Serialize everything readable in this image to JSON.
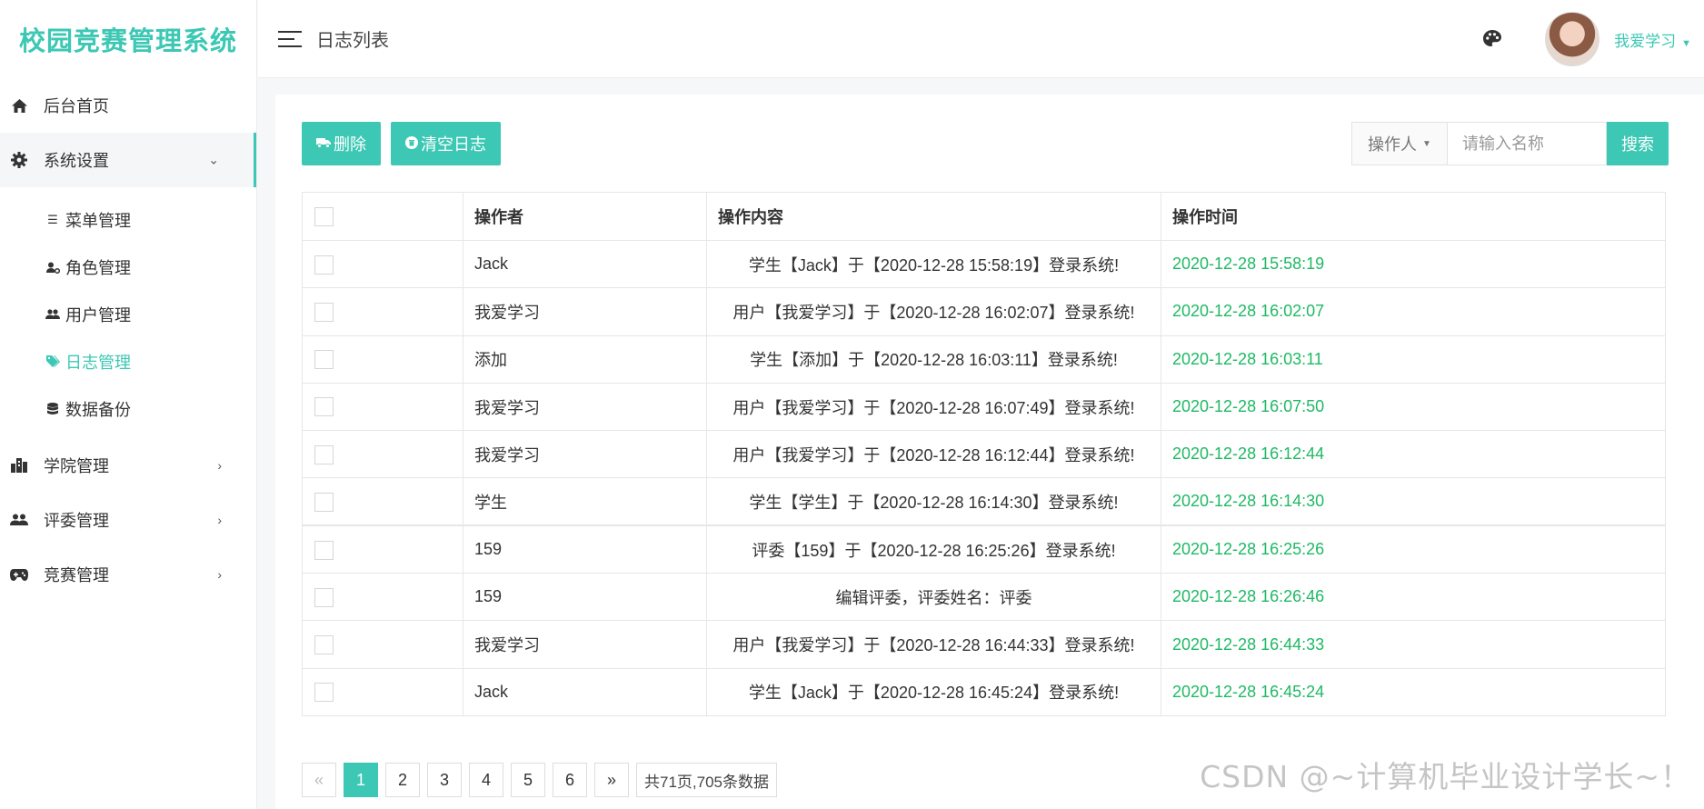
{
  "app": {
    "title": "校园竞赛管理系统"
  },
  "sidebar": {
    "items": [
      {
        "label": "后台首页",
        "icon": "home-icon"
      },
      {
        "label": "系统设置",
        "icon": "gear-icon",
        "expanded": true,
        "children": [
          {
            "label": "菜单管理",
            "icon": "list-icon"
          },
          {
            "label": "角色管理",
            "icon": "user-cog-icon"
          },
          {
            "label": "用户管理",
            "icon": "users-icon"
          },
          {
            "label": "日志管理",
            "icon": "tags-icon",
            "active": true
          },
          {
            "label": "数据备份",
            "icon": "database-icon"
          }
        ]
      },
      {
        "label": "学院管理",
        "icon": "building-icon"
      },
      {
        "label": "评委管理",
        "icon": "group-icon"
      },
      {
        "label": "竞赛管理",
        "icon": "gamepad-icon"
      }
    ]
  },
  "header": {
    "page_title": "日志列表",
    "username": "我爱学习"
  },
  "toolbar": {
    "delete_label": "删除",
    "clear_label": "清空日志"
  },
  "search": {
    "select_label": "操作人",
    "placeholder": "请输入名称",
    "button_label": "搜索"
  },
  "table": {
    "columns": [
      "",
      "操作者",
      "操作内容",
      "操作时间"
    ],
    "rows": [
      {
        "operator": "Jack",
        "content": "学生【Jack】于【2020-12-28 15:58:19】登录系统!",
        "time": "2020-12-28 15:58:19"
      },
      {
        "operator": "我爱学习",
        "content": "用户【我爱学习】于【2020-12-28 16:02:07】登录系统!",
        "time": "2020-12-28 16:02:07"
      },
      {
        "operator": "添加",
        "content": "学生【添加】于【2020-12-28 16:03:11】登录系统!",
        "time": "2020-12-28 16:03:11"
      },
      {
        "operator": "我爱学习",
        "content": "用户【我爱学习】于【2020-12-28 16:07:49】登录系统!",
        "time": "2020-12-28 16:07:50"
      },
      {
        "operator": "我爱学习",
        "content": "用户【我爱学习】于【2020-12-28 16:12:44】登录系统!",
        "time": "2020-12-28 16:12:44"
      },
      {
        "operator": "学生",
        "content": "学生【学生】于【2020-12-28 16:14:30】登录系统!",
        "time": "2020-12-28 16:14:30"
      },
      {
        "operator": "159",
        "content": "评委【159】于【2020-12-28 16:25:26】登录系统!",
        "time": "2020-12-28 16:25:26"
      },
      {
        "operator": "159",
        "content": "编辑评委，评委姓名：评委",
        "time": "2020-12-28 16:26:46"
      },
      {
        "operator": "我爱学习",
        "content": "用户【我爱学习】于【2020-12-28 16:44:33】登录系统!",
        "time": "2020-12-28 16:44:33"
      },
      {
        "operator": "Jack",
        "content": "学生【Jack】于【2020-12-28 16:45:24】登录系统!",
        "time": "2020-12-28 16:45:24"
      }
    ]
  },
  "pagination": {
    "prev": "«",
    "pages": [
      "1",
      "2",
      "3",
      "4",
      "5",
      "6"
    ],
    "current": "1",
    "next": "»",
    "summary": "共71页,705条数据"
  },
  "watermark": "CSDN @~计算机毕业设计学长~！",
  "colors": {
    "accent": "#3cc8b4",
    "time_green": "#1fb964"
  }
}
